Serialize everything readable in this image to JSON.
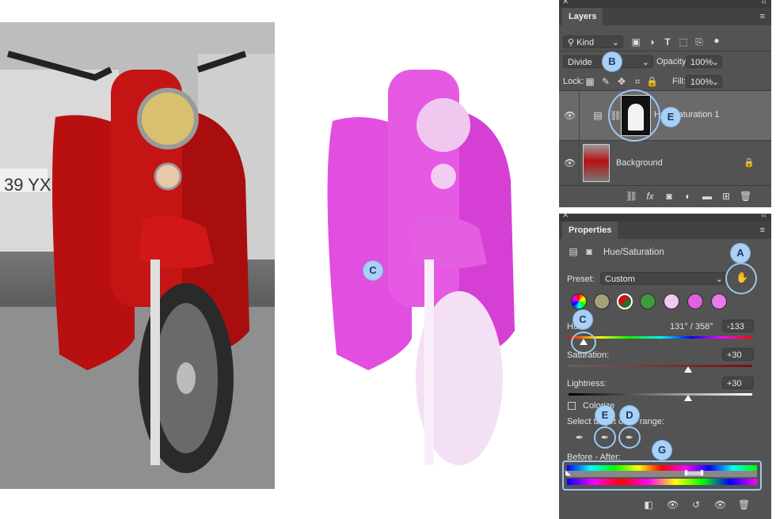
{
  "layers_panel": {
    "title": "Layers",
    "filter_kind": "Kind",
    "blend_mode": "Divide",
    "opacity_label": "Opacity:",
    "opacity_value": "100%",
    "lock_label": "Lock:",
    "fill_label": "Fill:",
    "fill_value": "100%",
    "layers": [
      {
        "name": "Hue/Saturation 1"
      },
      {
        "name": "Background"
      }
    ]
  },
  "properties_panel": {
    "title": "Properties",
    "adjustment_name": "Hue/Saturation",
    "preset_label": "Preset:",
    "preset_value": "Custom",
    "hue_label": "Hue:",
    "hue_range": "131° / 358°",
    "hue_value": "-133",
    "saturation_label": "Saturation:",
    "saturation_value": "+30",
    "lightness_label": "Lightness:",
    "lightness_value": "+30",
    "colorize_label": "Colorize",
    "select_color_label": "Select target color range:",
    "before_after_label": "Before - After:"
  },
  "callouts": {
    "a": "A",
    "b": "B",
    "c": "C",
    "d": "D",
    "e": "E",
    "g": "G"
  },
  "colors": {
    "panel_bg": "#535353",
    "callout": "#a9d0f5",
    "scooter_red": "#c41414",
    "scooter_magenta": "#e040dd"
  }
}
